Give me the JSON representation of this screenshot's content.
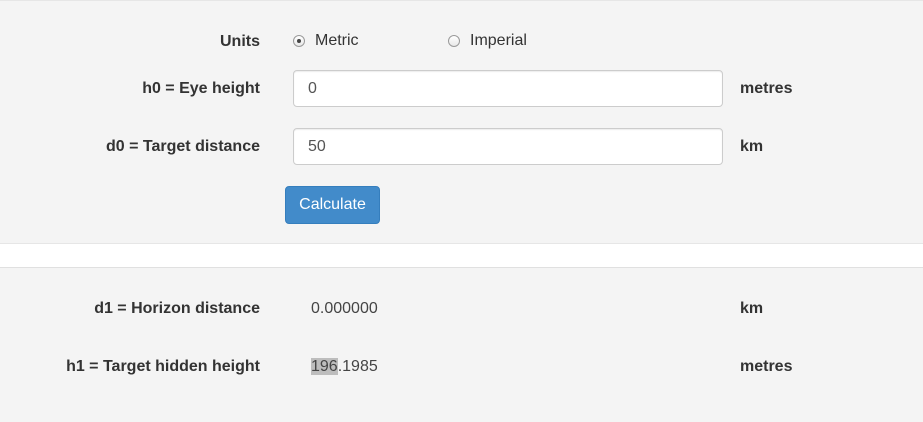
{
  "form": {
    "units_label": "Units",
    "unit_options": [
      {
        "label": "Metric",
        "checked": true
      },
      {
        "label": "Imperial",
        "checked": false
      }
    ],
    "eye_height": {
      "label": "h0 = Eye height",
      "value": "0",
      "unit": "metres"
    },
    "target_distance": {
      "label": "d0 = Target distance",
      "value": "50",
      "unit": "km"
    },
    "calculate_label": "Calculate"
  },
  "results": {
    "horizon_distance": {
      "label": "d1 = Horizon distance",
      "value": "0.000000",
      "unit": "km"
    },
    "hidden_height": {
      "label": "h1 = Target hidden height",
      "value_selected": "196",
      "value_rest": ".1985",
      "unit": "metres"
    }
  },
  "colors": {
    "panel_bg": "#f4f4f4",
    "button_bg": "#428bca",
    "selection_bg": "#bdbdbd"
  }
}
